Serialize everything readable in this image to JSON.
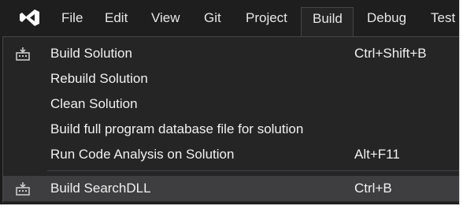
{
  "menubar": {
    "logo": "visual-studio-logo-icon",
    "items": [
      {
        "label": "File"
      },
      {
        "label": "Edit"
      },
      {
        "label": "View"
      },
      {
        "label": "Git"
      },
      {
        "label": "Project"
      },
      {
        "label": "Build",
        "active": true
      },
      {
        "label": "Debug"
      },
      {
        "label": "Test"
      }
    ]
  },
  "build_menu": {
    "items": [
      {
        "label": "Build Solution",
        "shortcut": "Ctrl+Shift+B",
        "icon": "build-icon"
      },
      {
        "label": "Rebuild Solution",
        "shortcut": ""
      },
      {
        "label": "Clean Solution",
        "shortcut": ""
      },
      {
        "label": "Build full program database file for solution",
        "shortcut": ""
      },
      {
        "label": "Run Code Analysis on Solution",
        "shortcut": "Alt+F11"
      },
      {
        "label": "Build SearchDLL",
        "shortcut": "Ctrl+B",
        "icon": "build-icon",
        "highlighted": true
      }
    ]
  },
  "colors": {
    "menubar_bg": "#1e1e1e",
    "dropdown_bg": "#252526",
    "highlight_bg": "#3e3e40",
    "text": "#f1f1f1",
    "logo_accent": "#ffffff"
  }
}
